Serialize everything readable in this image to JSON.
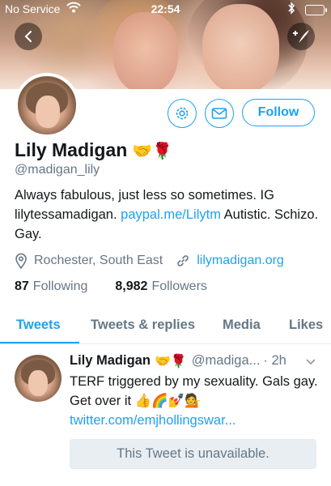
{
  "status_bar": {
    "carrier": "No Service",
    "time": "22:54"
  },
  "profile": {
    "name": "Lily Madigan",
    "name_emoji": "🤝🌹",
    "handle": "@madigan_lily",
    "bio_text_1": "Always fabulous, just less so sometimes. IG lilytessamadigan. ",
    "bio_link": "paypal.me/Lilytm",
    "bio_text_2": " Autistic. Schizo. Gay.",
    "location": "Rochester, South East",
    "website": "lilymadigan.org",
    "following_count": "87",
    "following_label": "Following",
    "followers_count": "8,982",
    "followers_label": "Followers",
    "follow_label": "Follow"
  },
  "tabs": [
    {
      "label": "Tweets"
    },
    {
      "label": "Tweets & replies"
    },
    {
      "label": "Media"
    },
    {
      "label": "Likes"
    }
  ],
  "tweet": {
    "name": "Lily Madigan",
    "name_emoji": "🤝🌹",
    "handle": "@madiga...",
    "time": "· 2h",
    "text": "TERF triggered by my sexuality. Gals gay. Get over it 👍🌈💅💁",
    "link": "twitter.com/emjhollingswar...",
    "unavailable": "This Tweet is unavailable."
  },
  "colors": {
    "accent": "#1da1f2",
    "secondary_text": "#657786"
  }
}
